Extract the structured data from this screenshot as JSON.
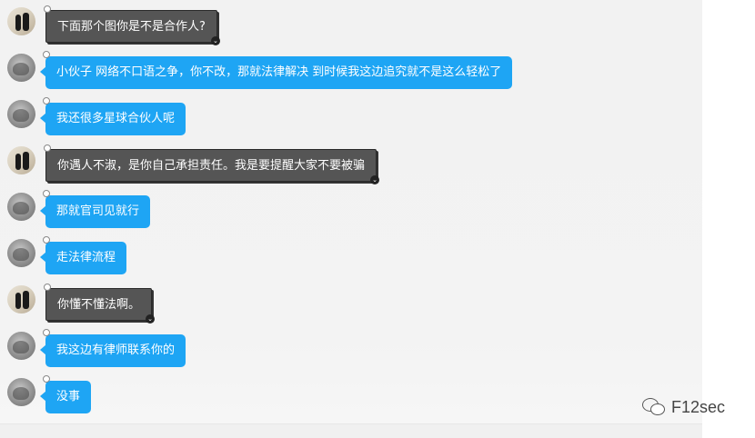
{
  "messages": [
    {
      "text": "下面那个图你是不是合作人?",
      "style": "dark",
      "avatar": "photo"
    },
    {
      "text": "小伙子 网络不口语之争，你不改，那就法律解决 到时候我这边追究就不是这么轻松了",
      "style": "blue",
      "avatar": "gray"
    },
    {
      "text": "我还很多星球合伙人呢",
      "style": "blue",
      "avatar": "gray"
    },
    {
      "text": "你遇人不淑，是你自己承担责任。我是要提醒大家不要被骗",
      "style": "dark",
      "avatar": "photo"
    },
    {
      "text": "那就官司见就行",
      "style": "blue",
      "avatar": "gray"
    },
    {
      "text": "走法律流程",
      "style": "blue",
      "avatar": "gray"
    },
    {
      "text": "你懂不懂法啊。",
      "style": "dark",
      "avatar": "photo"
    },
    {
      "text": "我这边有律师联系你的",
      "style": "blue",
      "avatar": "gray"
    },
    {
      "text": "没事",
      "style": "blue",
      "avatar": "gray"
    }
  ],
  "watermark": {
    "text": "F12sec",
    "icon": "wechat-icon"
  },
  "colors": {
    "blue_bubble": "#1ea5f4",
    "dark_bubble": "#555555",
    "panel_bg": "#f2f2f2"
  }
}
